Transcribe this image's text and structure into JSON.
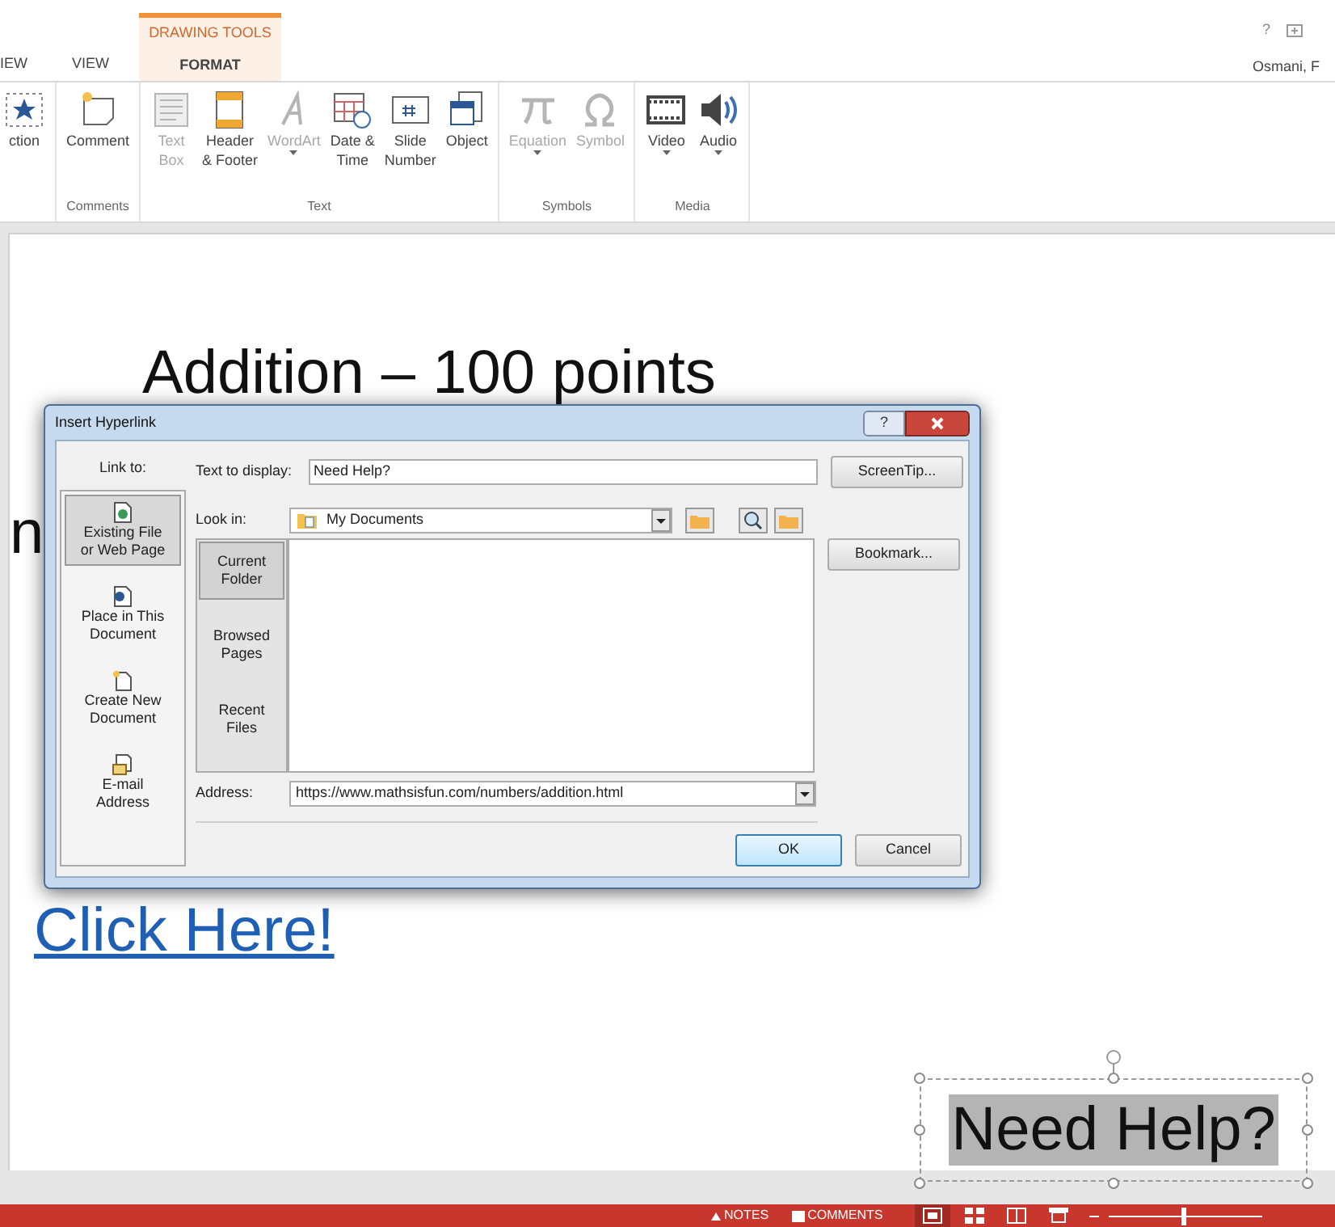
{
  "ribbon": {
    "contextual_header": "DRAWING TOOLS",
    "tabs": [
      {
        "label": "IEW",
        "selected": false
      },
      {
        "label": "VIEW",
        "selected": false
      },
      {
        "label": "FORMAT",
        "selected": true
      }
    ],
    "help": "?",
    "user": "Osmani, F",
    "groups": [
      {
        "buttons": [
          {
            "kind": "star",
            "lines": [
              "ction"
            ],
            "disabled": false,
            "has_menu": false
          }
        ]
      },
      {
        "label": "Comments",
        "buttons": [
          {
            "kind": "comment",
            "lines": [
              "Comment"
            ],
            "disabled": false,
            "has_menu": false
          }
        ]
      },
      {
        "label": "Text",
        "buttons": [
          {
            "kind": "textbox",
            "lines": [
              "Text",
              "Box"
            ],
            "disabled": true,
            "has_menu": false
          },
          {
            "kind": "header",
            "lines": [
              "Header",
              "& Footer"
            ],
            "disabled": false,
            "has_menu": false
          },
          {
            "kind": "wordart",
            "lines": [
              "WordArt"
            ],
            "disabled": true,
            "has_menu": true
          },
          {
            "kind": "datetime",
            "lines": [
              "Date &",
              "Time"
            ],
            "disabled": false,
            "has_menu": false
          },
          {
            "kind": "slidenumber",
            "lines": [
              "Slide",
              "Number"
            ],
            "disabled": false,
            "has_menu": false
          },
          {
            "kind": "object",
            "lines": [
              "Object"
            ],
            "disabled": false,
            "has_menu": false
          }
        ]
      },
      {
        "label": "Symbols",
        "buttons": [
          {
            "kind": "pi",
            "lines": [
              "Equation"
            ],
            "disabled": true,
            "has_menu": true
          },
          {
            "kind": "omega",
            "lines": [
              "Symbol"
            ],
            "disabled": true,
            "has_menu": false
          }
        ]
      },
      {
        "label": "Media",
        "buttons": [
          {
            "kind": "video",
            "lines": [
              "Video"
            ],
            "disabled": false,
            "has_menu": true
          },
          {
            "kind": "audio",
            "lines": [
              "Audio"
            ],
            "disabled": false,
            "has_menu": true
          }
        ]
      }
    ]
  },
  "slide": {
    "title": "Addition – 100 points",
    "partial_text": "n",
    "link": "Click Here!",
    "text_box": {
      "text": "Need Help?",
      "selected": true
    }
  },
  "dialog": {
    "title": "Insert Hyperlink",
    "help": "?",
    "link_to_label": "Link to:",
    "link_to": [
      {
        "kind": "file",
        "lines": [
          "Existing File",
          "or Web Page"
        ],
        "selected": true
      },
      {
        "kind": "place",
        "lines": [
          "Place in This",
          "Document"
        ],
        "selected": false
      },
      {
        "kind": "new",
        "lines": [
          "Create New",
          "Document"
        ],
        "selected": false
      },
      {
        "kind": "mail",
        "lines": [
          "E-mail",
          "Address"
        ],
        "selected": false
      }
    ],
    "text_to_display": {
      "label": "Text to display:",
      "value": "Need Help?"
    },
    "look_in": {
      "label": "Look in:",
      "value": "My Documents"
    },
    "browse_tabs": [
      {
        "lines": [
          "Current",
          "Folder"
        ],
        "selected": true
      },
      {
        "lines": [
          "Browsed",
          "Pages"
        ],
        "selected": false
      },
      {
        "lines": [
          "Recent",
          "Files"
        ],
        "selected": false
      }
    ],
    "address": {
      "label": "Address:",
      "value": "https://www.mathsisfun.com/numbers/addition.html"
    },
    "screentip": "ScreenTip...",
    "bookmark": "Bookmark...",
    "ok": "OK",
    "cancel": "Cancel"
  },
  "status_bar": {
    "notes": "NOTES",
    "comments": "COMMENTS",
    "views": [
      {
        "kind": "normal",
        "selected": true
      },
      {
        "kind": "sorter",
        "selected": false
      },
      {
        "kind": "reading",
        "selected": false
      },
      {
        "kind": "show",
        "selected": false
      }
    ],
    "zoom": {
      "level": 0.47
    }
  }
}
